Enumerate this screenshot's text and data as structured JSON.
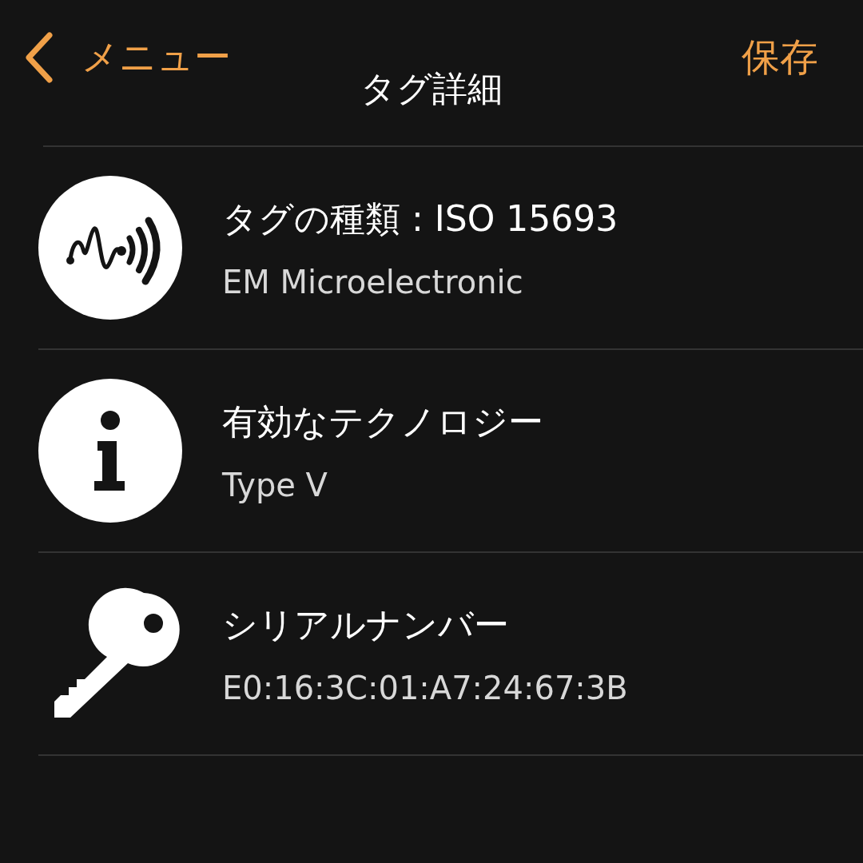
{
  "nav": {
    "back_label": "メニュー",
    "title": "タグ詳細",
    "save_label": "保存"
  },
  "rows": [
    {
      "kind": "signal",
      "title": "タグの種類 : ISO 15693",
      "subtitle": "EM Microelectronic"
    },
    {
      "kind": "info",
      "title": "有効なテクノロジー",
      "subtitle": "Type V"
    },
    {
      "kind": "key",
      "title": "シリアルナンバー",
      "subtitle": "E0:16:3C:01:A7:24:67:3B"
    }
  ]
}
